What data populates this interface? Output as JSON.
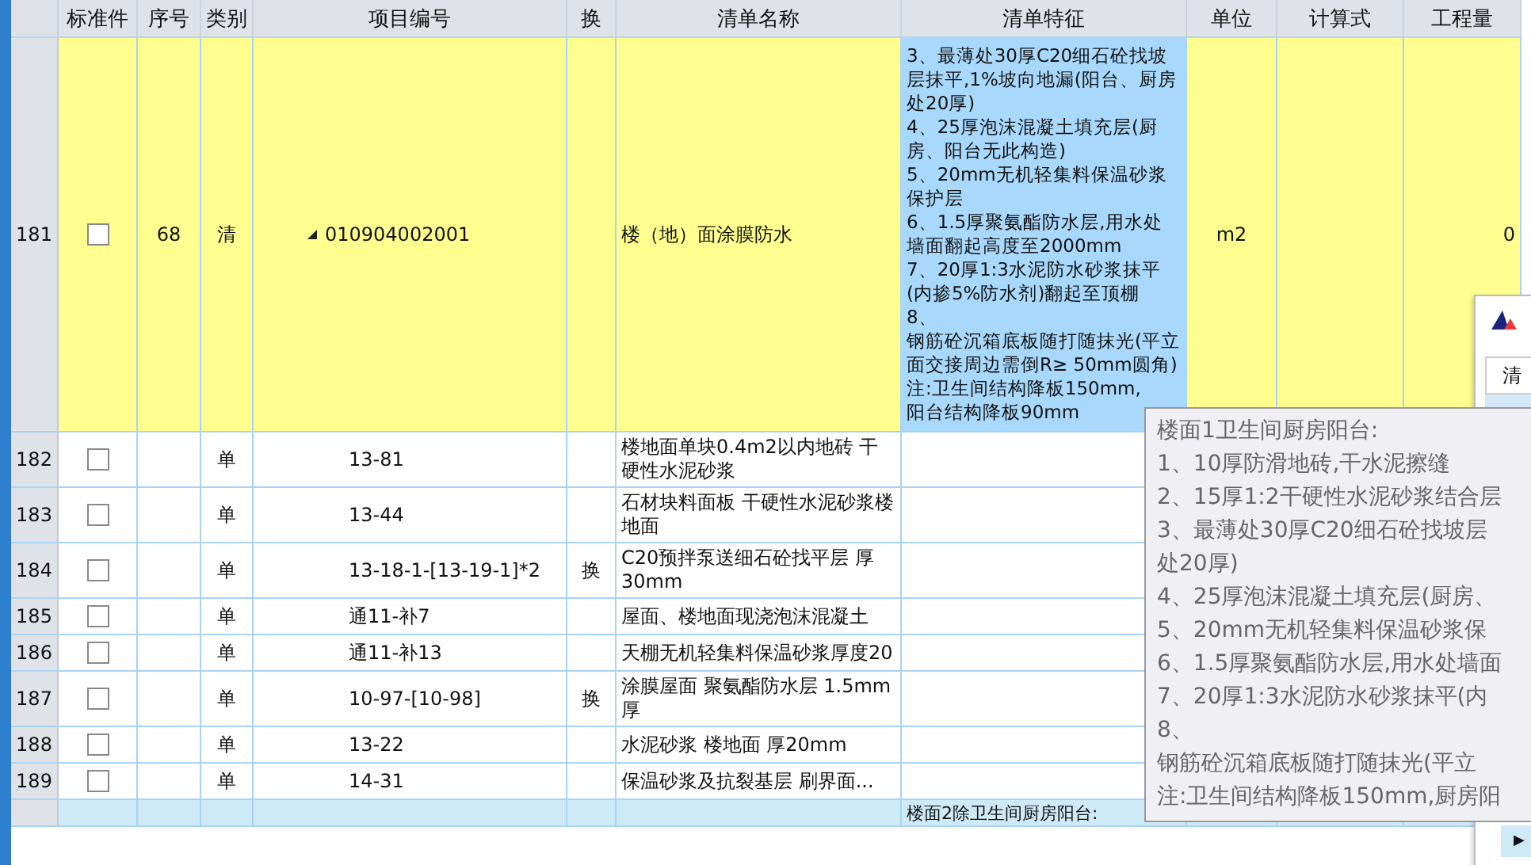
{
  "table": {
    "columns": [
      "标准件",
      "序号",
      "类别",
      "项目编号",
      "换",
      "清单名称",
      "清单特征",
      "单位",
      "计算式",
      "工程量"
    ],
    "rows": [
      {
        "row_number": "181",
        "checked": false,
        "highlighted": true,
        "seq": "68",
        "kind_label": "清",
        "code": "010904002001",
        "expanded": true,
        "swap": "",
        "name": "楼（地）面涂膜防水",
        "features": [
          "3、最薄处30厚C20细石砼找坡层抹平,1%坡向地漏(阳台、厨房处20厚)",
          "4、25厚泡沫混凝土填充层(厨房、阳台无此构造)",
          "5、20mm无机轻集料保温砂浆保护层",
          "6、1.5厚聚氨酯防水层,用水处墙面翻起高度至2000mm",
          "7、20厚1:3水泥防水砂浆抹平(内掺5%防水剂)翻起至顶棚",
          "8、",
          "钢筋砼沉箱底板随打随抹光(平立面交接周边需倒R≥ 50mm圆角)",
          "注:卫生间结构降板150mm,",
          "阳台结构降板90mm"
        ],
        "unit": "m2",
        "quantity": "0"
      },
      {
        "row_number": "182",
        "checked": false,
        "highlighted": false,
        "seq": "",
        "kind_label": "单",
        "code": "13-81",
        "swap": "",
        "name": "楼地面单块0.4m2以内地砖 干硬性水泥砂浆",
        "features": [],
        "unit": "",
        "quantity": ""
      },
      {
        "row_number": "183",
        "checked": false,
        "highlighted": false,
        "seq": "",
        "kind_label": "单",
        "code": "13-44",
        "swap": "",
        "name": "石材块料面板 干硬性水泥砂浆楼地面",
        "features": [],
        "unit": "",
        "quantity": ""
      },
      {
        "row_number": "184",
        "checked": false,
        "highlighted": false,
        "seq": "",
        "kind_label": "单",
        "code": "13-18-1-[13-19-1]*2",
        "swap": "换",
        "name": "C20预拌泵送细石砼找平层 厚30mm",
        "features": [],
        "unit": "",
        "quantity": ""
      },
      {
        "row_number": "185",
        "checked": false,
        "highlighted": false,
        "seq": "",
        "kind_label": "单",
        "code": "通11-补7",
        "swap": "",
        "name": "屋面、楼地面现浇泡沫混凝土",
        "features": [],
        "unit": "",
        "quantity": ""
      },
      {
        "row_number": "186",
        "checked": false,
        "highlighted": false,
        "seq": "",
        "kind_label": "单",
        "code": "通11-补13",
        "swap": "",
        "name": "天棚无机轻集料保温砂浆厚度20",
        "features": [],
        "unit": "",
        "quantity": ""
      },
      {
        "row_number": "187",
        "checked": false,
        "highlighted": false,
        "seq": "",
        "kind_label": "单",
        "code": "10-97-[10-98]",
        "swap": "换",
        "name": "涂膜屋面 聚氨酯防水层 1.5mm厚",
        "features": [],
        "unit": "",
        "quantity": ""
      },
      {
        "row_number": "188",
        "checked": false,
        "highlighted": false,
        "seq": "",
        "kind_label": "单",
        "code": "13-22",
        "swap": "",
        "name": "水泥砂浆 楼地面 厚20mm",
        "features": [],
        "unit": "",
        "quantity": ""
      },
      {
        "row_number": "189",
        "checked": false,
        "highlighted": false,
        "seq": "",
        "kind_label": "单",
        "code": "14-31",
        "swap": "",
        "name": "保温砂浆及抗裂基层 刷界面...",
        "features": [],
        "unit": "",
        "quantity": ""
      }
    ],
    "next_row": {
      "features": "楼面2除卫生间厨房阳台:"
    }
  },
  "side_window": {
    "header": "清",
    "expand_arrow": "▶"
  },
  "tooltip": {
    "title": "楼面1卫生间厨房阳台:",
    "lines": [
      "1、10厚防滑地砖,干水泥擦缝",
      "2、15厚1:2干硬性水泥砂浆结合层",
      "3、最薄处30厚C20细石砼找坡层",
      "处20厚)",
      "4、25厚泡沫混凝土填充层(厨房、",
      "5、20mm无机轻集料保温砂浆保",
      "6、1.5厚聚氨酯防水层,用水处墙面",
      "7、20厚1:3水泥防水砂浆抹平(内",
      "8、",
      "钢筋砼沉箱底板随打随抹光(平立",
      "注:卫生间结构降板150mm,厨房阳"
    ]
  }
}
